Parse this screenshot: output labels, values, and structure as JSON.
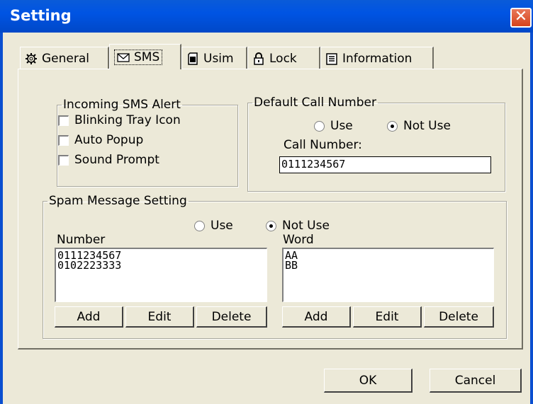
{
  "window": {
    "title": "Setting",
    "close_glyph": "✕"
  },
  "tabs": [
    {
      "label": "General",
      "icon": "gear-icon"
    },
    {
      "label": "SMS",
      "icon": "envelope-icon"
    },
    {
      "label": "Usim",
      "icon": "sim-card-icon"
    },
    {
      "label": "Lock",
      "icon": "padlock-icon"
    },
    {
      "label": "Information",
      "icon": "document-icon"
    }
  ],
  "active_tab": "SMS",
  "incoming": {
    "legend": "Incoming SMS Alert",
    "options": [
      {
        "label": "Blinking Tray Icon",
        "checked": false
      },
      {
        "label": "Auto Popup",
        "checked": false
      },
      {
        "label": "Sound Prompt",
        "checked": false
      }
    ]
  },
  "default_call": {
    "legend": "Default Call Number",
    "use_label": "Use",
    "not_use_label": "Not Use",
    "selected": "Not Use",
    "call_number_label": "Call Number:",
    "call_number_value": "0111234567"
  },
  "spam": {
    "legend": "Spam Message Setting",
    "use_label": "Use",
    "not_use_label": "Not Use",
    "selected": "Not Use",
    "number_label": "Number",
    "numbers": [
      "0111234567",
      "0102223333"
    ],
    "word_label": "Word",
    "words": [
      "AA",
      "BB"
    ],
    "buttons": {
      "add": "Add",
      "edit": "Edit",
      "delete": "Delete"
    }
  },
  "footer": {
    "ok": "OK",
    "cancel": "Cancel"
  }
}
